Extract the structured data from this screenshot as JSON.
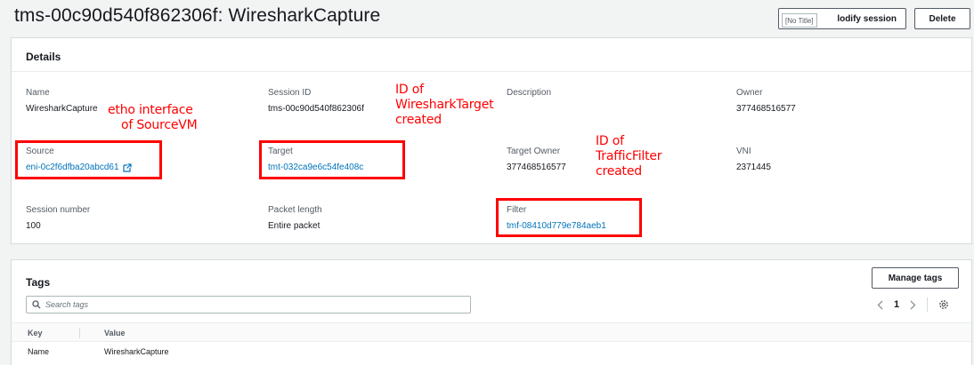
{
  "header": {
    "title": "tms-00c90d540f862306f: WiresharkCapture",
    "modify_label": "Modify session",
    "modify_visible_label": "lodify session",
    "tooltip": "[No Title]",
    "delete_label": "Delete"
  },
  "details": {
    "section_title": "Details",
    "fields": {
      "name": {
        "label": "Name",
        "value": "WiresharkCapture"
      },
      "session_id": {
        "label": "Session ID",
        "value": "tms-00c90d540f862306f"
      },
      "description": {
        "label": "Description",
        "value": ""
      },
      "owner": {
        "label": "Owner",
        "value": "377468516577"
      },
      "source": {
        "label": "Source",
        "value": "eni-0c2f6dfba20abcd61"
      },
      "target": {
        "label": "Target",
        "value": "tmt-032ca9e6c54fe408c"
      },
      "target_owner": {
        "label": "Target Owner",
        "value": "377468516577"
      },
      "vni": {
        "label": "VNI",
        "value": "2371445"
      },
      "session_number": {
        "label": "Session number",
        "value": "100"
      },
      "packet_length": {
        "label": "Packet length",
        "value": "Entire packet"
      },
      "filter": {
        "label": "Filter",
        "value": "tmf-08410d779e784aeb1"
      }
    }
  },
  "annotations": {
    "source_note": [
      "etho interface",
      "of SourceVM"
    ],
    "target_note": [
      "ID of",
      "WiresharkTarget",
      "created"
    ],
    "filter_note": [
      "ID of",
      "TrafficFilter",
      "created"
    ],
    "color": "#ff0000"
  },
  "tags": {
    "section_title": "Tags",
    "manage_label": "Manage tags",
    "search_placeholder": "Search tags",
    "page": "1",
    "columns": [
      "Key",
      "Value"
    ],
    "rows": [
      {
        "key": "Name",
        "value": "WiresharkCapture"
      }
    ]
  },
  "colors": {
    "link": "#0073bb",
    "annotation": "#ff0000",
    "background": "#f2f3f3"
  },
  "icons": [
    "external-link-icon",
    "search-icon",
    "chevron-left-icon",
    "chevron-right-icon",
    "settings-gear-icon"
  ]
}
